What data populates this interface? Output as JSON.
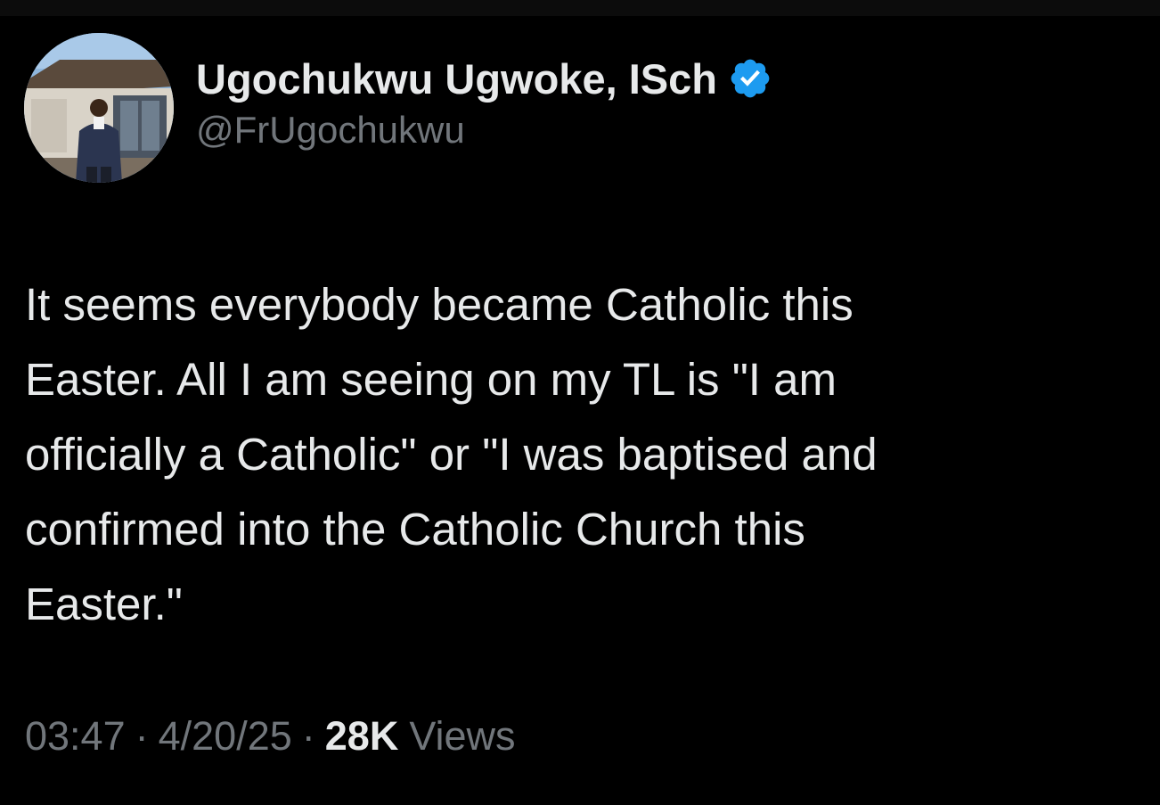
{
  "author": {
    "display_name": "Ugochukwu Ugwoke, ISch",
    "handle": "@FrUgochukwu",
    "verified_icon": "verified-badge-icon",
    "verified_color": "#1d9bf0"
  },
  "tweet": {
    "text": "It seems everybody became Catholic this\nEaster. All I am seeing on my TL is \"I am\nofficially a Catholic\" or \"I was baptised and\nconfirmed into the Catholic Church this\nEaster.\""
  },
  "meta": {
    "time": "03:47",
    "separator": "·",
    "date": "4/20/25",
    "views_count": "28K",
    "views_label": "Views"
  },
  "colors": {
    "background": "#000000",
    "primary_text": "#e7e9ea",
    "secondary_text": "#71767b"
  }
}
